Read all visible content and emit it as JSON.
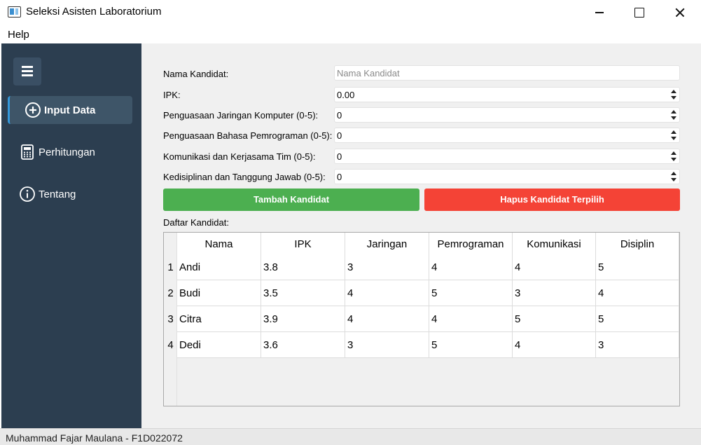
{
  "window": {
    "title": "Seleksi Asisten Laboratorium"
  },
  "menu": {
    "help": "Help"
  },
  "sidebar": {
    "items": [
      {
        "label": "Input Data",
        "icon": "plus-circle-icon",
        "active": true
      },
      {
        "label": "Perhitungan",
        "icon": "calculator-icon",
        "active": false
      },
      {
        "label": "Tentang",
        "icon": "info-icon",
        "active": false
      }
    ]
  },
  "form": {
    "fields": [
      {
        "label": "Nama Kandidat:",
        "value": "",
        "placeholder": "Nama Kandidat",
        "type": "text"
      },
      {
        "label": "IPK:",
        "value": "0.00",
        "type": "spinbox"
      },
      {
        "label": "Penguasaan Jaringan Komputer (0-5):",
        "value": "0",
        "type": "spinbox"
      },
      {
        "label": "Penguasaan Bahasa Pemrograman (0-5):",
        "value": "0",
        "type": "spinbox"
      },
      {
        "label": "Komunikasi dan Kerjasama Tim (0-5):",
        "value": "0",
        "type": "spinbox"
      },
      {
        "label": "Kedisiplinan dan Tanggung Jawab (0-5):",
        "value": "0",
        "type": "spinbox"
      }
    ],
    "add_button": "Tambah Kandidat",
    "delete_button": "Hapus Kandidat Terpilih"
  },
  "table": {
    "title": "Daftar Kandidat:",
    "columns": [
      "Nama",
      "IPK",
      "Jaringan",
      "Pemrograman",
      "Komunikasi",
      "Disiplin"
    ],
    "rows": [
      {
        "num": "1",
        "cells": [
          "Andi",
          "3.8",
          "3",
          "4",
          "4",
          "5"
        ]
      },
      {
        "num": "2",
        "cells": [
          "Budi",
          "3.5",
          "4",
          "5",
          "3",
          "4"
        ]
      },
      {
        "num": "3",
        "cells": [
          "Citra",
          "3.9",
          "4",
          "4",
          "5",
          "5"
        ]
      },
      {
        "num": "4",
        "cells": [
          "Dedi",
          "3.6",
          "3",
          "5",
          "4",
          "3"
        ]
      }
    ]
  },
  "statusbar": {
    "text": "Muhammad Fajar Maulana - F1D022072"
  },
  "colors": {
    "sidebar": "#2c3e50",
    "add_button": "#4caf50",
    "delete_button": "#f44336",
    "active_accent": "#3498db"
  }
}
